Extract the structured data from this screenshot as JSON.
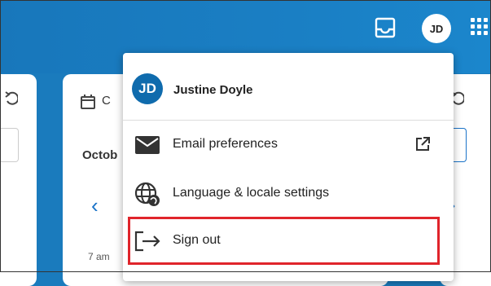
{
  "header": {
    "avatar_initials": "JD"
  },
  "calendar_card": {
    "title_partial": "C",
    "month_partial": "Octob",
    "time_label": "7 am"
  },
  "account_menu": {
    "avatar_initials": "JD",
    "user_name": "Justine Doyle",
    "items": [
      {
        "label": "Email preferences",
        "icon": "envelope-icon",
        "trailing_icon": "external-link-icon"
      },
      {
        "label": "Language & locale settings",
        "icon": "globe-icon"
      },
      {
        "label": "Sign out",
        "icon": "sign-out-icon"
      }
    ]
  },
  "colors": {
    "header_bg": "#1a7bbd",
    "avatar_bg": "#0f6bad",
    "accent": "#1a73c8",
    "highlight": "#e0242b"
  }
}
